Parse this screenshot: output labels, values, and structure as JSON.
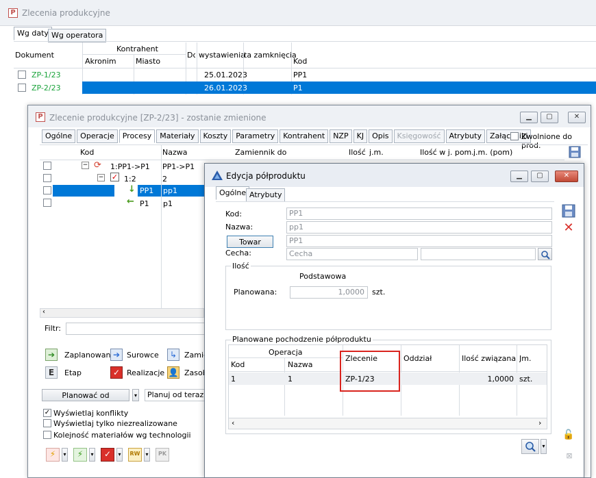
{
  "main_window": {
    "title": "Zlecenia produkcyjne",
    "tabs": [
      "Wg daty",
      "Wg operatora"
    ],
    "columns": {
      "dokument": "Dokument",
      "kontrahent": "Kontrahent",
      "akronim": "Akronim",
      "miasto": "Miasto",
      "do": "Dc",
      "wystawienia": "wystawienia",
      "zamkniecia": "ta zamknięcia",
      "kod": "Kod"
    },
    "rows": [
      {
        "dokument": "ZP-1/23",
        "wystawienia": "25.01.2023",
        "kod": "PP1",
        "selected": false
      },
      {
        "dokument": "ZP-2/23",
        "wystawienia": "26.01.2023",
        "kod": "P1",
        "selected": true
      }
    ]
  },
  "order_window": {
    "title": "Zlecenie produkcyjne  [ZP-2/23] - zostanie zmienione",
    "tabs": [
      "Ogólne",
      "Operacje",
      "Procesy",
      "Materiały",
      "Koszty",
      "Parametry",
      "Kontrahent",
      "NZP",
      "KJ",
      "Opis",
      "Księgowość",
      "Atrybuty",
      "Załączniki"
    ],
    "active_tab": "Procesy",
    "zwolnione_label": "Zwolnione do prod.",
    "columns": {
      "kod": "Kod",
      "nazwa": "Nazwa",
      "zamiennik": "Zamiennik do",
      "ilosc": "Ilość",
      "jm": "j.m.",
      "ilosc_pom": "Ilość w j. pom.",
      "jm_pom": "j.m. (pom)"
    },
    "tree": [
      {
        "kod": "1:PP1->P1",
        "nazwa": "PP1->P1"
      },
      {
        "kod": "1:2",
        "nazwa": "2"
      },
      {
        "kod": "PP1",
        "nazwa": "pp1"
      },
      {
        "kod": "P1",
        "nazwa": "p1"
      }
    ],
    "filter_label": "Filtr:",
    "legend": {
      "zaplanowane": "Zaplanowane",
      "surowce": "Surowce",
      "zamiennik": "Zamie",
      "etap": "Etap",
      "realizacje": "Realizacje",
      "zasoby": "Zasob"
    },
    "planowac_od": "Planować od",
    "planuj_od": "Planuj od teraz",
    "checkboxes": [
      {
        "label": "Wyświetlaj konflikty",
        "checked": true
      },
      {
        "label": "Wyświetlaj tylko niezrealizowane",
        "checked": false
      },
      {
        "label": "Kolejność materiałów wg technologii",
        "checked": false
      }
    ]
  },
  "edit_window": {
    "title": "Edycja półproduktu",
    "tabs": [
      "Ogólne",
      "Atrybuty"
    ],
    "kod_label": "Kod:",
    "kod_value": "PP1",
    "nazwa_label": "Nazwa:",
    "nazwa_value": "pp1",
    "towar_button": "Towar",
    "towar_value": "PP1",
    "cecha_label": "Cecha:",
    "cecha_placeholder": "Cecha",
    "ilosc_group": "Ilość",
    "podstawowa_label": "Podstawowa",
    "planowana_label": "Planowana:",
    "planowana_value": "1,0000",
    "planowana_unit": "szt.",
    "pochodzenie_group": "Planowane pochodzenie półproduktu",
    "columns": {
      "operacja": "Operacja",
      "kod": "Kod",
      "nazwa": "Nazwa",
      "zlecenie": "Zlecenie",
      "oddzial": "Oddział",
      "ilosc": "Ilość związana",
      "jm": "Jm."
    },
    "row": {
      "kod": "1",
      "nazwa": "1",
      "zlecenie": "ZP-1/23",
      "oddzial": "",
      "ilosc": "1,0000",
      "jm": "szt."
    }
  }
}
